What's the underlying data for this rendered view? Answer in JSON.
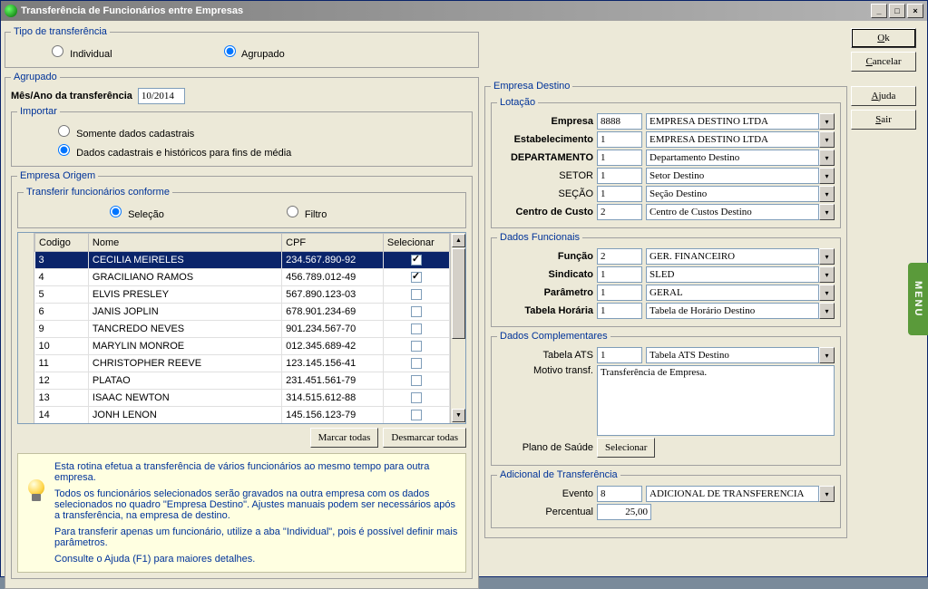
{
  "titlebar": {
    "title": "Transferência de Funcionários entre Empresas"
  },
  "win_buttons": {
    "min": "_",
    "max": "□",
    "close": "×"
  },
  "tipo": {
    "legend": "Tipo de transferência",
    "individual": "Individual",
    "agrupado": "Agrupado"
  },
  "agrupado": {
    "legend": "Agrupado",
    "mes_ano_label": "Mês/Ano da transferência",
    "mes_ano_value": "10/2014"
  },
  "importar": {
    "legend": "Importar",
    "opt1": "Somente dados cadastrais",
    "opt2": "Dados cadastrais e históricos para fins de média"
  },
  "origem": {
    "legend": "Empresa Origem",
    "transferir_legend": "Transferir funcionários conforme",
    "selecao": "Seleção",
    "filtro": "Filtro",
    "col_codigo": "Codigo",
    "col_nome": "Nome",
    "col_cpf": "CPF",
    "col_selecionar": "Selecionar",
    "marcar": "Marcar todas",
    "desmarcar": "Desmarcar todas",
    "rows": [
      {
        "codigo": "3",
        "nome": "CECILIA MEIRELES",
        "cpf": "234.567.890-92",
        "sel": true,
        "highlight": true
      },
      {
        "codigo": "4",
        "nome": "GRACILIANO RAMOS",
        "cpf": "456.789.012-49",
        "sel": true
      },
      {
        "codigo": "5",
        "nome": "ELVIS PRESLEY",
        "cpf": "567.890.123-03",
        "sel": false
      },
      {
        "codigo": "6",
        "nome": "JANIS JOPLIN",
        "cpf": "678.901.234-69",
        "sel": false
      },
      {
        "codigo": "9",
        "nome": "TANCREDO NEVES",
        "cpf": "901.234.567-70",
        "sel": false
      },
      {
        "codigo": "10",
        "nome": "MARYLIN MONROE",
        "cpf": "012.345.689-42",
        "sel": false
      },
      {
        "codigo": "11",
        "nome": "CHRISTOPHER REEVE",
        "cpf": "123.145.156-41",
        "sel": false
      },
      {
        "codigo": "12",
        "nome": "PLATAO",
        "cpf": "231.451.561-79",
        "sel": false
      },
      {
        "codigo": "13",
        "nome": "ISAAC NEWTON",
        "cpf": "314.515.612-88",
        "sel": false
      },
      {
        "codigo": "14",
        "nome": "JONH LENON",
        "cpf": "145.156.123-79",
        "sel": false
      }
    ]
  },
  "help": {
    "p1": "Esta rotina efetua a transferência de vários funcionários ao mesmo tempo para outra empresa.",
    "p2": "Todos os funcionários selecionados serão gravados na outra empresa com os dados selecionados no quadro \"Empresa Destino\". Ajustes manuais podem ser necessários após a transferência, na empresa de destino.",
    "p3": "Para transferir apenas um funcionário, utilize a aba \"Individual\", pois é possível definir mais parâmetros.",
    "p4": "Consulte o Ajuda (F1) para maiores detalhes."
  },
  "destino": {
    "legend": "Empresa Destino",
    "lotacao_legend": "Lotação",
    "empresa_label": "Empresa",
    "empresa_code": "8888",
    "empresa_desc": "EMPRESA DESTINO LTDA",
    "estab_label": "Estabelecimento",
    "estab_code": "1",
    "estab_desc": "EMPRESA DESTINO LTDA",
    "depto_label": "DEPARTAMENTO",
    "depto_code": "1",
    "depto_desc": "Departamento Destino",
    "setor_label": "SETOR",
    "setor_code": "1",
    "setor_desc": "Setor Destino",
    "secao_label": "SEÇÃO",
    "secao_code": "1",
    "secao_desc": "Seção Destino",
    "cc_label": "Centro de Custo",
    "cc_code": "2",
    "cc_desc": "Centro de Custos Destino",
    "func_legend": "Dados Funcionais",
    "funcao_label": "Função",
    "funcao_code": "2",
    "funcao_desc": "GER. FINANCEIRO",
    "sind_label": "Sindicato",
    "sind_code": "1",
    "sind_desc": "SLED",
    "param_label": "Parâmetro",
    "param_code": "1",
    "param_desc": "GERAL",
    "tab_label": "Tabela Horária",
    "tab_code": "1",
    "tab_desc": "Tabela de Horário Destino",
    "compl_legend": "Dados Complementares",
    "ats_label": "Tabela ATS",
    "ats_code": "1",
    "ats_desc": "Tabela ATS Destino",
    "motivo_label": "Motivo transf.",
    "motivo_value": "Transferência de Empresa.",
    "plano_label": "Plano de Saúde",
    "plano_btn": "Selecionar",
    "adic_legend": "Adicional de Transferência",
    "evento_label": "Evento",
    "evento_code": "8",
    "evento_desc": "ADICIONAL DE TRANSFERENCIA",
    "perc_label": "Percentual",
    "perc_value": "25,00"
  },
  "buttons": {
    "ok": "Ok",
    "ok_u": "O",
    "cancelar": "Cancelar",
    "cancelar_u": "C",
    "ajuda": "Ajuda",
    "ajuda_u": "A",
    "sair": "Sair",
    "sair_u": "S"
  },
  "side_menu": "MENU",
  "chevron": "▾",
  "up": "▲",
  "down": "▼"
}
